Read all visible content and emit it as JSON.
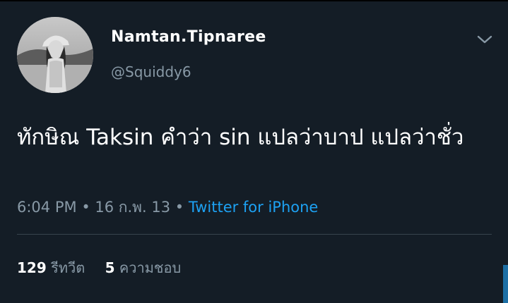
{
  "tweet": {
    "display_name": "Namtan.Tipnaree",
    "handle": "@Squiddy6",
    "text": "ทักษิณ Taksin คำว่า sin แปลว่าบาป แปลว่าชั่ว",
    "time": "6:04 PM",
    "separator": "•",
    "date": "16 ก.พ. 13",
    "source": "Twitter for iPhone"
  },
  "stats": {
    "retweets_count": "129",
    "retweets_label": "รีทวีต",
    "likes_count": "5",
    "likes_label": "ความชอบ"
  },
  "icons": {
    "menu": "chevron-down-icon"
  },
  "colors": {
    "background": "#141d26",
    "text_primary": "#ffffff",
    "text_secondary": "#8899a6",
    "link": "#1da1f2",
    "divider": "#38444d"
  }
}
